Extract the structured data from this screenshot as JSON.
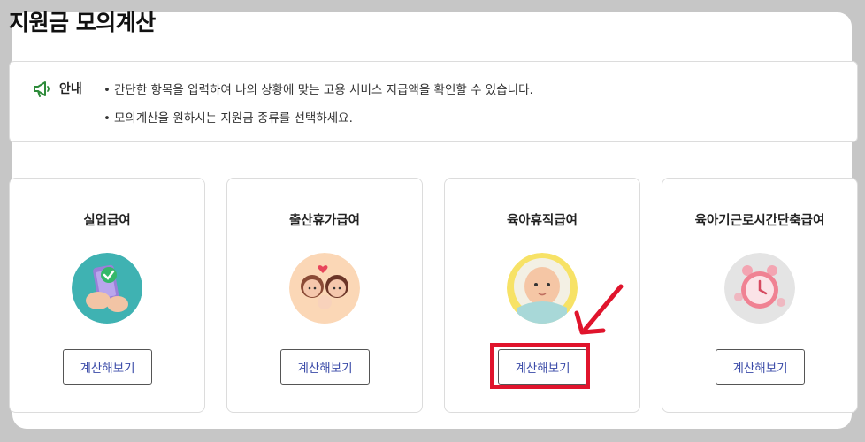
{
  "page": {
    "title": "지원금 모의계산"
  },
  "notice": {
    "icon": "megaphone-icon",
    "label": "안내",
    "lines": [
      "간단한 항목을 입력하여 나의 상황에 맞는 고용 서비스 지급액을 확인할 수 있습니다.",
      "모의계산을 원하시는 지원금 종류를 선택하세요."
    ]
  },
  "cards": [
    {
      "title": "실업급여",
      "icon": "phone-check-icon",
      "button": "계산해보기"
    },
    {
      "title": "출산휴가급여",
      "icon": "family-icon",
      "button": "계산해보기"
    },
    {
      "title": "육아휴직급여",
      "icon": "baby-icon",
      "button": "계산해보기"
    },
    {
      "title": "육아기근로시간단축급여",
      "icon": "alarm-clock-icon",
      "button": "계산해보기"
    }
  ],
  "colors": {
    "accent_text": "#3b4ba8",
    "notice_icon": "#2e8b3a",
    "annotation": "#e0142c"
  }
}
